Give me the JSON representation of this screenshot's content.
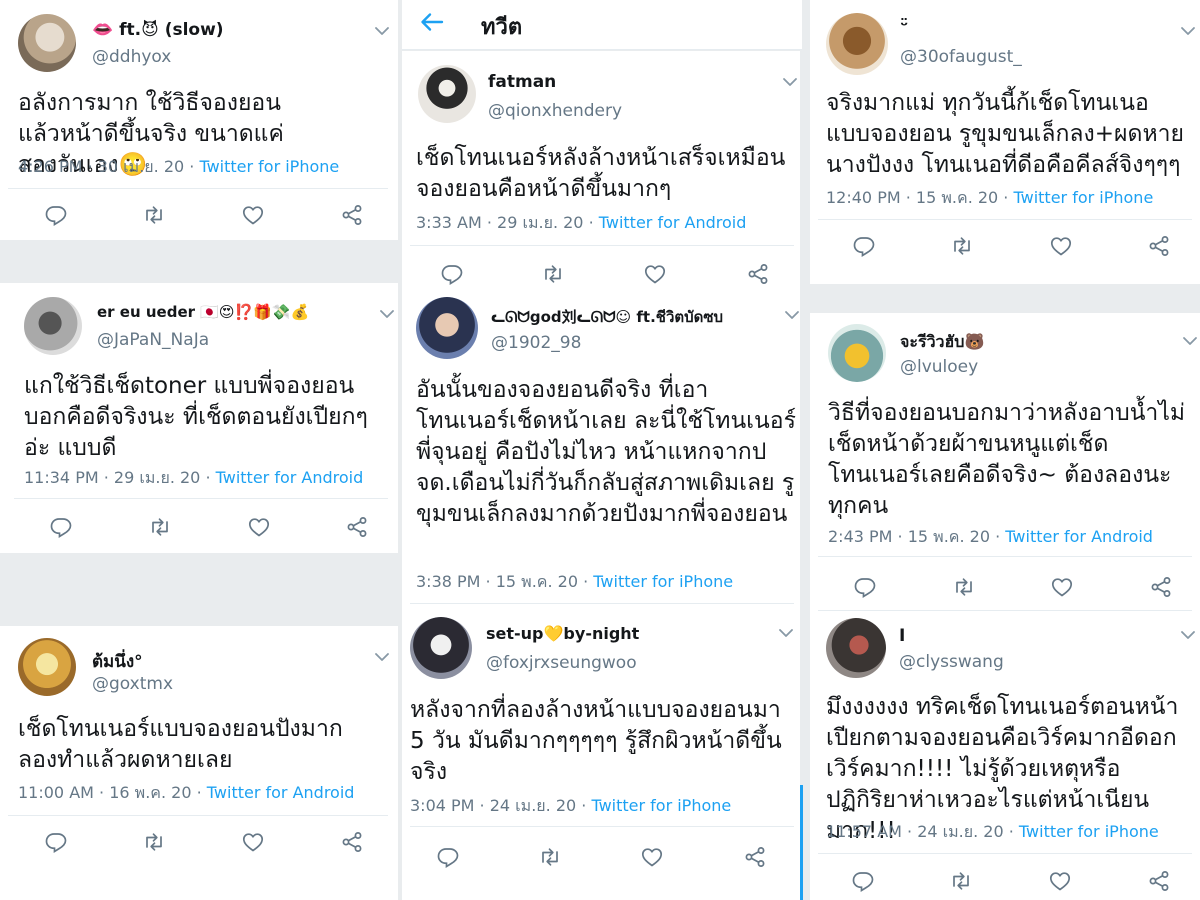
{
  "header": {
    "title": "ทวีต"
  },
  "tweets": [
    {
      "name": "👄 ft.😈 (slow)",
      "handle": "@ddhyox",
      "body": "อลังการมาก ใช้วิธีจองยอนแล้วหน้าดีขึ้นจริง ขนาดแค่สองวันเอง🙄",
      "time": "4:26 PM · 30 เม.ย. 20 · ",
      "source": "Twitter for iPhone"
    },
    {
      "name": "er eu ueder 🇯🇵😍⁉️🎁💸💰",
      "handle": "@JaPaN_NaJa",
      "body": "แกใช้วิธีเช็ดtoner แบบพี่จองยอนบอกคือดีจริงนะ ที่เช็ดตอนยังเปียกๆ อ่ะ แบบดี",
      "time": "11:34 PM · 29 เม.ย. 20 · ",
      "source": "Twitter for Android"
    },
    {
      "name": "ต้มนึ่ง°",
      "handle": "@goxtmx",
      "body": "เช็ดโทนเนอร์แบบจองยอนปังมาก ลองทำแล้วผดหายเลย",
      "time": "11:00 AM · 16 พ.ค. 20 · ",
      "source": "Twitter for Android"
    },
    {
      "name": "fatman",
      "handle": "@qionxhendery",
      "body": "เช็ดโทนเนอร์หลังล้างหน้าเสร็จเหมือนจองยอนคือหน้าดีขึ้นมากๆ",
      "time": "3:33 AM · 29 เม.ย. 20 · ",
      "source": "Twitter for Android"
    },
    {
      "name": "ᓚᘏᗢgod刘ᓚᘏᗢ☺ ft.ชีวิตบัดซบ",
      "handle": "@1902_98",
      "body": "อันนั้นของจองยอนดีจริง ที่เอาโทนเนอร์เช็ดหน้าเลย ละนี่ใช้โทนเนอร์พี่จุนอยู่ คือปังไม่ไหว หน้าแหกจากปจด.เดือนไม่กี่วันก็กลับสู่สภาพเดิมเลย รูขุมขนเล็กลงมากด้วยปังมากพี่จองยอน",
      "time": "3:38 PM · 15 พ.ค. 20 · ",
      "source": "Twitter for iPhone"
    },
    {
      "name": "set-up💛by-night",
      "handle": "@foxjrxseungwoo",
      "body": "หลังจากที่ลองล้างหน้าแบบจองยอนมา 5 วัน มันดีมากๆๆๆๆๆ รู้สึกผิวหน้าดีขึ้นจริง",
      "time": "3:04 PM · 24 เม.ย. 20 · ",
      "source": "Twitter for iPhone"
    },
    {
      "name": "ᵕ̈",
      "handle": "@30ofaugust_",
      "body": "จริงมากแม่ ทุกวันนี้ก้เช็ดโทนเนอแบบจองยอน รูขุมขนเล็กลง+ผดหาย นางปังงง โทนเนอที่ดีอคือคีลส์จิงๆๆๆ",
      "time": "12:40 PM · 15 พ.ค. 20 · ",
      "source": "Twitter for iPhone"
    },
    {
      "name": "จะรีวิวฮับ🐻",
      "handle": "@lvuloey",
      "body": "วิธีที่จองยอนบอกมาว่าหลังอาบน้ำไม่เช็ดหน้าด้วยผ้าขนหนูแต่เช็ดโทนเนอร์เลยคือดีจริง~ ต้องลองนะทุกคน",
      "time": "2:43 PM · 15 พ.ค. 20 · ",
      "source": "Twitter for Android"
    },
    {
      "name": "I",
      "handle": "@clysswang",
      "body": "มึงงงงงง ทริคเช็ดโทนเนอร์ตอนหน้าเปียกตามจองยอนคือเวิร์คมากอีดอกเวิร์คมาก!!!! ไม่รู้ด้วยเหตุหรือปฏิกิริยาห่าเหวอะไรแต่หน้าเนียนมาก!!!",
      "time": "11:57 AM · 24 เม.ย. 20 · ",
      "source": "Twitter for iPhone"
    }
  ]
}
